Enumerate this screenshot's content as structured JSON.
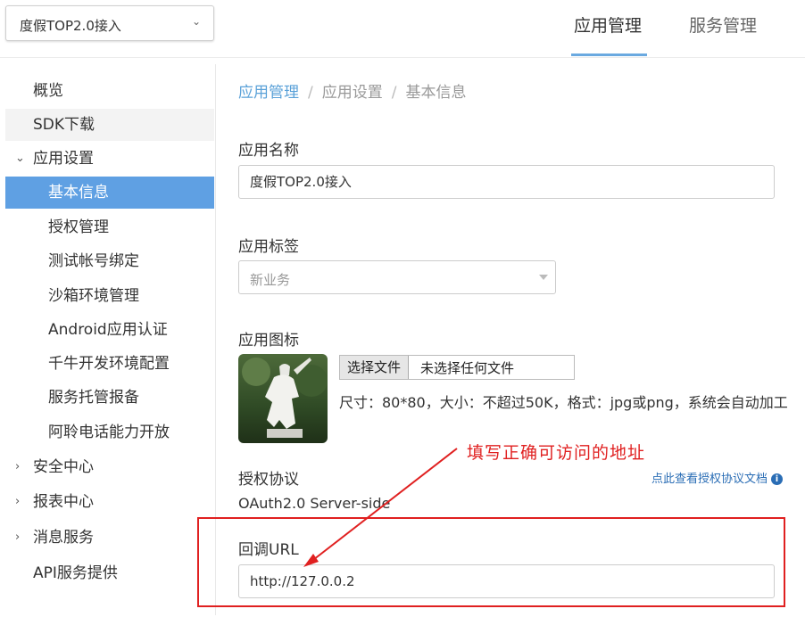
{
  "header": {
    "app_select_value": "度假TOP2.0接入",
    "tabs": [
      {
        "label": "应用管理",
        "active": true
      },
      {
        "label": "服务管理",
        "active": false
      }
    ],
    "accent_color": "#6aa9e0"
  },
  "sidebar": {
    "items": [
      {
        "label": "概览"
      },
      {
        "label": "SDK下载"
      },
      {
        "label": "应用设置",
        "expanded": true
      },
      {
        "label": "基本信息",
        "active": true
      },
      {
        "label": "授权管理"
      },
      {
        "label": "测试帐号绑定"
      },
      {
        "label": "沙箱环境管理"
      },
      {
        "label": "Android应用认证"
      },
      {
        "label": "千牛开发环境配置"
      },
      {
        "label": "服务托管报备"
      },
      {
        "label": "阿聆电话能力开放"
      },
      {
        "label": "安全中心",
        "expanded": false
      },
      {
        "label": "报表中心",
        "expanded": false
      },
      {
        "label": "消息服务",
        "expanded": false
      },
      {
        "label": "API服务提供"
      }
    ],
    "active_color": "#5fa0e3"
  },
  "breadcrumb": [
    "应用管理",
    "应用设置",
    "基本信息"
  ],
  "form": {
    "app_name_label": "应用名称",
    "app_name_value": "度假TOP2.0接入",
    "app_tag_label": "应用标签",
    "app_tag_placeholder": "新业务",
    "app_icon_label": "应用图标",
    "file_button": "选择文件",
    "file_status": "未选择任何文件",
    "size_hint": "尺寸：80*80，大小：不超过50K，格式：jpg或png，系统会自动加工",
    "auth_protocol_label": "授权协议",
    "auth_protocol_value": "OAuth2.0 Server-side",
    "auth_doc_link": "点此查看授权协议文档",
    "callback_label": "回调URL",
    "callback_value": "http://127.0.0.2"
  },
  "annotation": {
    "text": "填写正确可访问的地址",
    "color": "#e02020"
  },
  "icons": [
    "chevron-down-icon",
    "chevron-right-icon",
    "info-icon",
    "statue-app-icon"
  ]
}
